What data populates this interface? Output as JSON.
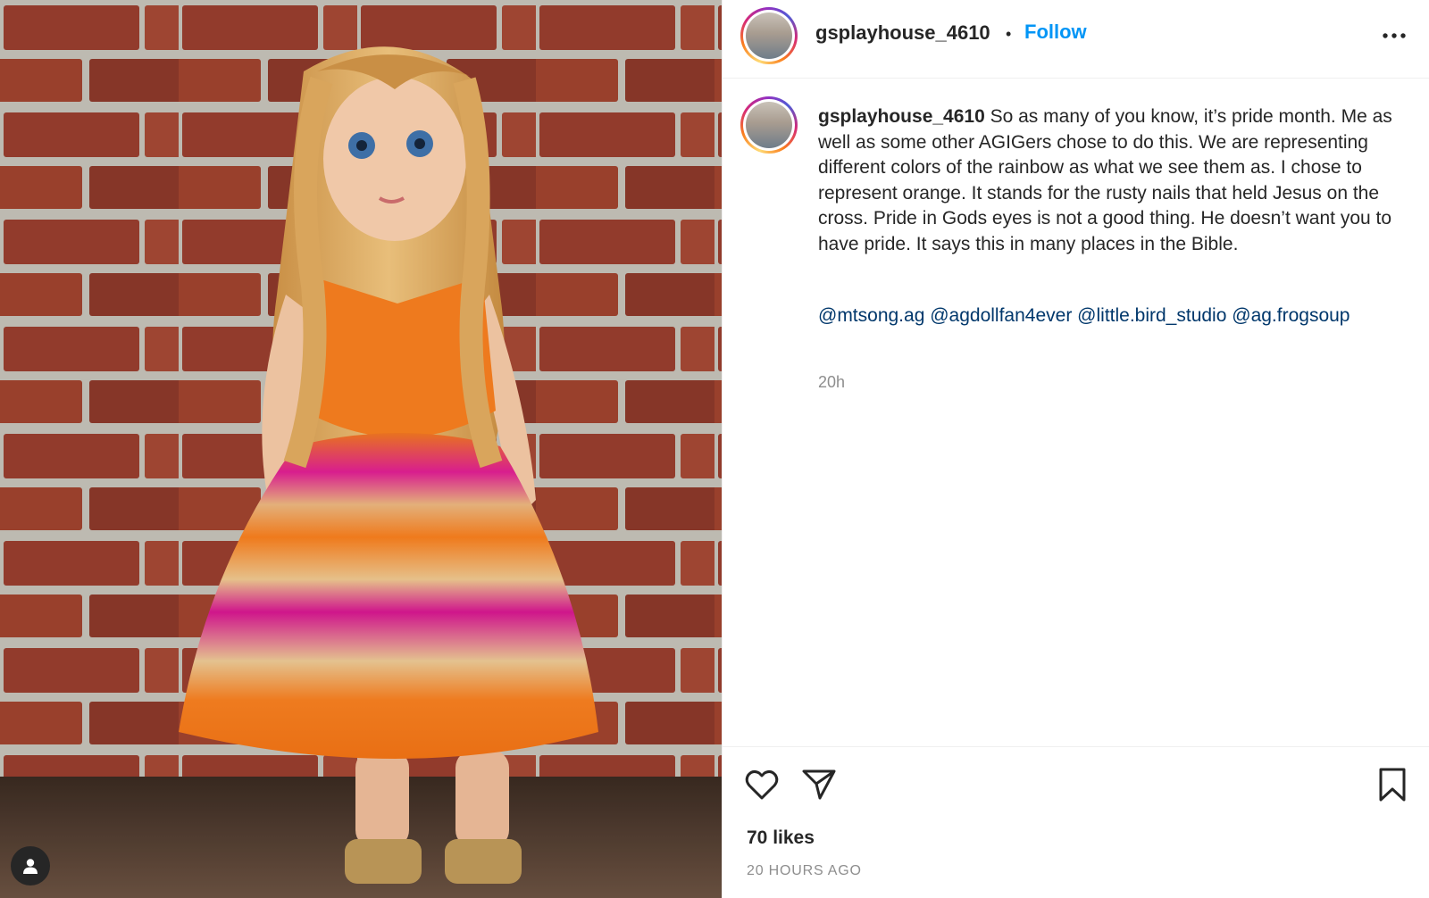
{
  "post": {
    "username": "gsplayhouse_4610",
    "separator": "•",
    "follow_label": "Follow",
    "caption_text": "So as many of you know, it’s pride month. Me as well as some other AGIGers chose to do this. We are representing different colors of the rainbow as what we see them as. I chose to represent orange. It stands for the rusty nails that held Jesus on the cross. Pride in Gods eyes is not a good thing. He doesn’t want you to have pride. It says this in many places in the Bible.",
    "mentions": [
      "@mtsong.ag",
      "@agdollfan4ever",
      "@little.bird_studio",
      "@ag.frogsoup"
    ],
    "time_ago": "20h",
    "likes": "70 likes",
    "posted_ago": "20 HOURS AGO"
  },
  "icons": {
    "more": "more-options-icon",
    "like": "heart-icon",
    "share": "paper-plane-icon",
    "save": "bookmark-icon",
    "user_tag": "user-tag-icon"
  },
  "colors": {
    "follow_blue": "#0095f6",
    "mention_blue": "#00376b",
    "muted": "#8e8e8e",
    "text": "#262626"
  }
}
